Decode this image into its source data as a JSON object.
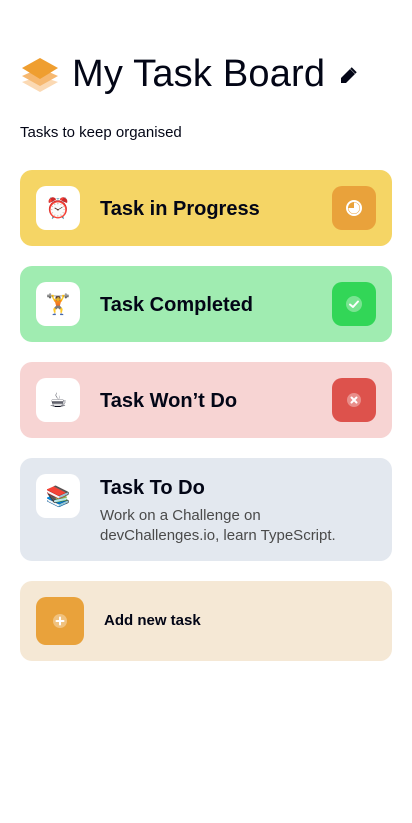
{
  "header": {
    "title": "My Task Board",
    "logo_icon": "stacked-layers-icon",
    "edit_icon": "pencil-icon"
  },
  "subtitle": "Tasks to keep organised",
  "tasks": [
    {
      "emoji": "⏰",
      "title": "Task in Progress",
      "status": "in-progress",
      "status_icon": "clock-progress-icon"
    },
    {
      "emoji": "🏋️",
      "title": "Task Completed",
      "status": "completed",
      "status_icon": "check-icon"
    },
    {
      "emoji": "☕",
      "title": "Task Won’t Do",
      "status": "wont-do",
      "status_icon": "close-icon"
    },
    {
      "emoji": "📚",
      "title": "Task To Do",
      "description": "Work on a Challenge on devChallenges.io, learn TypeScript.",
      "status": "to-do"
    }
  ],
  "add_task": {
    "label": "Add new task",
    "icon": "plus-icon"
  },
  "colors": {
    "in_progress_bg": "#f5d565",
    "completed_bg": "#a0ecb1",
    "wont_do_bg": "#f7d4d3",
    "todo_bg": "#e3e8ef",
    "add_bg": "#f5e8d5",
    "accent_orange": "#e9a23b",
    "accent_green": "#32d657",
    "accent_red": "#dd524c"
  }
}
